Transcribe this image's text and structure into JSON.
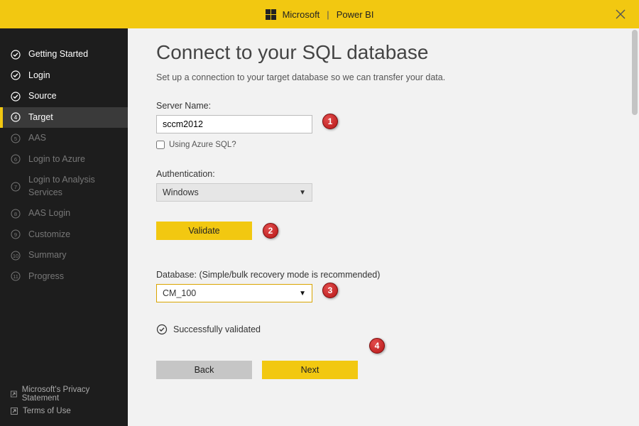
{
  "topbar": {
    "brand_left": "Microsoft",
    "brand_right": "Power BI",
    "divider": "|"
  },
  "sidebar": {
    "steps": [
      {
        "label": "Getting Started",
        "state": "done"
      },
      {
        "label": "Login",
        "state": "done"
      },
      {
        "label": "Source",
        "state": "done"
      },
      {
        "label": "Target",
        "state": "active",
        "num": "4"
      },
      {
        "label": "AAS",
        "state": "pending",
        "num": "5"
      },
      {
        "label": "Login to Azure",
        "state": "pending",
        "num": "6"
      },
      {
        "label": "Login to Analysis Services",
        "state": "pending",
        "num": "7"
      },
      {
        "label": "AAS Login",
        "state": "pending",
        "num": "8"
      },
      {
        "label": "Customize",
        "state": "pending",
        "num": "9"
      },
      {
        "label": "Summary",
        "state": "pending",
        "num": "10"
      },
      {
        "label": "Progress",
        "state": "pending",
        "num": "11"
      }
    ],
    "footer": {
      "privacy": "Microsoft's Privacy Statement",
      "terms": "Terms of Use"
    }
  },
  "main": {
    "title": "Connect to your SQL database",
    "subtitle": "Set up a connection to your target database so we can transfer your data.",
    "server_label": "Server Name:",
    "server_value": "sccm2012",
    "azure_checkbox_label": "Using Azure SQL?",
    "auth_label": "Authentication:",
    "auth_value": "Windows",
    "validate_button": "Validate",
    "database_label": "Database: (Simple/bulk recovery mode is recommended)",
    "database_value": "CM_100",
    "validated_text": "Successfully validated",
    "back_button": "Back",
    "next_button": "Next"
  },
  "callouts": {
    "c1": "1",
    "c2": "2",
    "c3": "3",
    "c4": "4"
  }
}
